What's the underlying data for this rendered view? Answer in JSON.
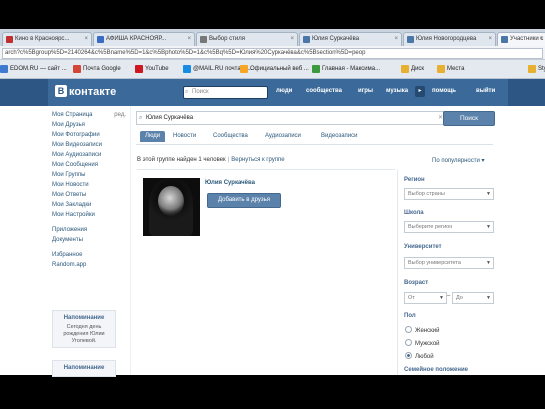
{
  "browser": {
    "tabs": [
      {
        "label": "Кино в Красноярс...",
        "color": "#c03030"
      },
      {
        "label": "АФИША КРАСНОЯР...",
        "color": "#3a6bc4"
      },
      {
        "label": "Выбор стиля",
        "color": "#777777"
      },
      {
        "label": "Юлия Суркачёва",
        "color": "#4a76a8"
      },
      {
        "label": "Юлия Новогородцева",
        "color": "#4a76a8"
      },
      {
        "label": "Участники с",
        "color": "#4a76a8",
        "active": true
      }
    ],
    "url": "arch?c%5Bgroup%5D=2140264&c%5Bname%5D=1&c%5Bphoto%5D=1&c%5Bq%5D=Юлия%20Суркачёва&c%5Bsection%5D=peop",
    "bookmarks": [
      {
        "label": "EDOM.RU — сайт ...",
        "color": "#3f7ad1"
      },
      {
        "label": "Почта Google",
        "color": "#d44638"
      },
      {
        "label": "YouTube",
        "color": "#cc181e"
      },
      {
        "label": "@MAIL.RU почта, н...",
        "color": "#168de2"
      },
      {
        "label": "Официальный веб ...",
        "color": "#f6a623"
      },
      {
        "label": "Главная - Максима...",
        "color": "#3b9a3b"
      },
      {
        "label": "Диск",
        "color": "#e8b030"
      },
      {
        "label": "Места",
        "color": "#e8b030"
      },
      {
        "label": "Styl",
        "color": "#e8b030"
      }
    ]
  },
  "header": {
    "logo_letter": "В",
    "logo_text": "контакте",
    "search_placeholder": "Поиск",
    "nav": [
      "люди",
      "сообщества",
      "игры",
      "музыка",
      "помощь",
      "выйти"
    ],
    "arrow": "▸"
  },
  "sidebar": {
    "items": [
      {
        "label": "Моя Страница",
        "count": "ред."
      },
      {
        "label": "Мои Друзья",
        "count": ""
      },
      {
        "label": "Мои Фотографии",
        "count": ""
      },
      {
        "label": "Мои Видеозаписи",
        "count": ""
      },
      {
        "label": "Мои Аудиозаписи",
        "count": ""
      },
      {
        "label": "Мои Сообщения",
        "count": ""
      },
      {
        "label": "Мои Группы",
        "count": ""
      },
      {
        "label": "Мои Новости",
        "count": ""
      },
      {
        "label": "Мои Ответы",
        "count": ""
      },
      {
        "label": "Мои Закладки",
        "count": ""
      },
      {
        "label": "Мои Настройки",
        "count": ""
      }
    ],
    "items2": [
      "Приложения",
      "Документы"
    ],
    "items3": [
      "Избранное",
      "Random.app"
    ],
    "box1_title": "Напоминание",
    "box1_text": "Сегодня день рождения Юлии Уголевой.",
    "box2_title": "Напоминание"
  },
  "main": {
    "search_value": "Юлия Суркачёва",
    "search_button": "Поиск",
    "tabs": [
      "Люди",
      "Новости",
      "Сообщества",
      "Аудиозаписи",
      "Видеозаписи"
    ],
    "result_count": "В этой группе найден 1 человек",
    "back_link": "Вернуться к группе",
    "sort": "По популярности ▾",
    "result_name": "Юлия Суркачёва",
    "add_friend": "Добавить в друзья"
  },
  "filters": {
    "region_label": "Регион",
    "region_value": "Выбор страны",
    "school_label": "Школа",
    "school_value": "Выберите регион",
    "university_label": "Университет",
    "university_value": "Выбор университета",
    "age_label": "Возраст",
    "age_from": "От",
    "age_to": "До",
    "age_dash": "–",
    "gender_label": "Пол",
    "gender_options": [
      "Женский",
      "Мужской",
      "Любой"
    ],
    "gender_selected": 2,
    "marital_label": "Семейное положение"
  }
}
